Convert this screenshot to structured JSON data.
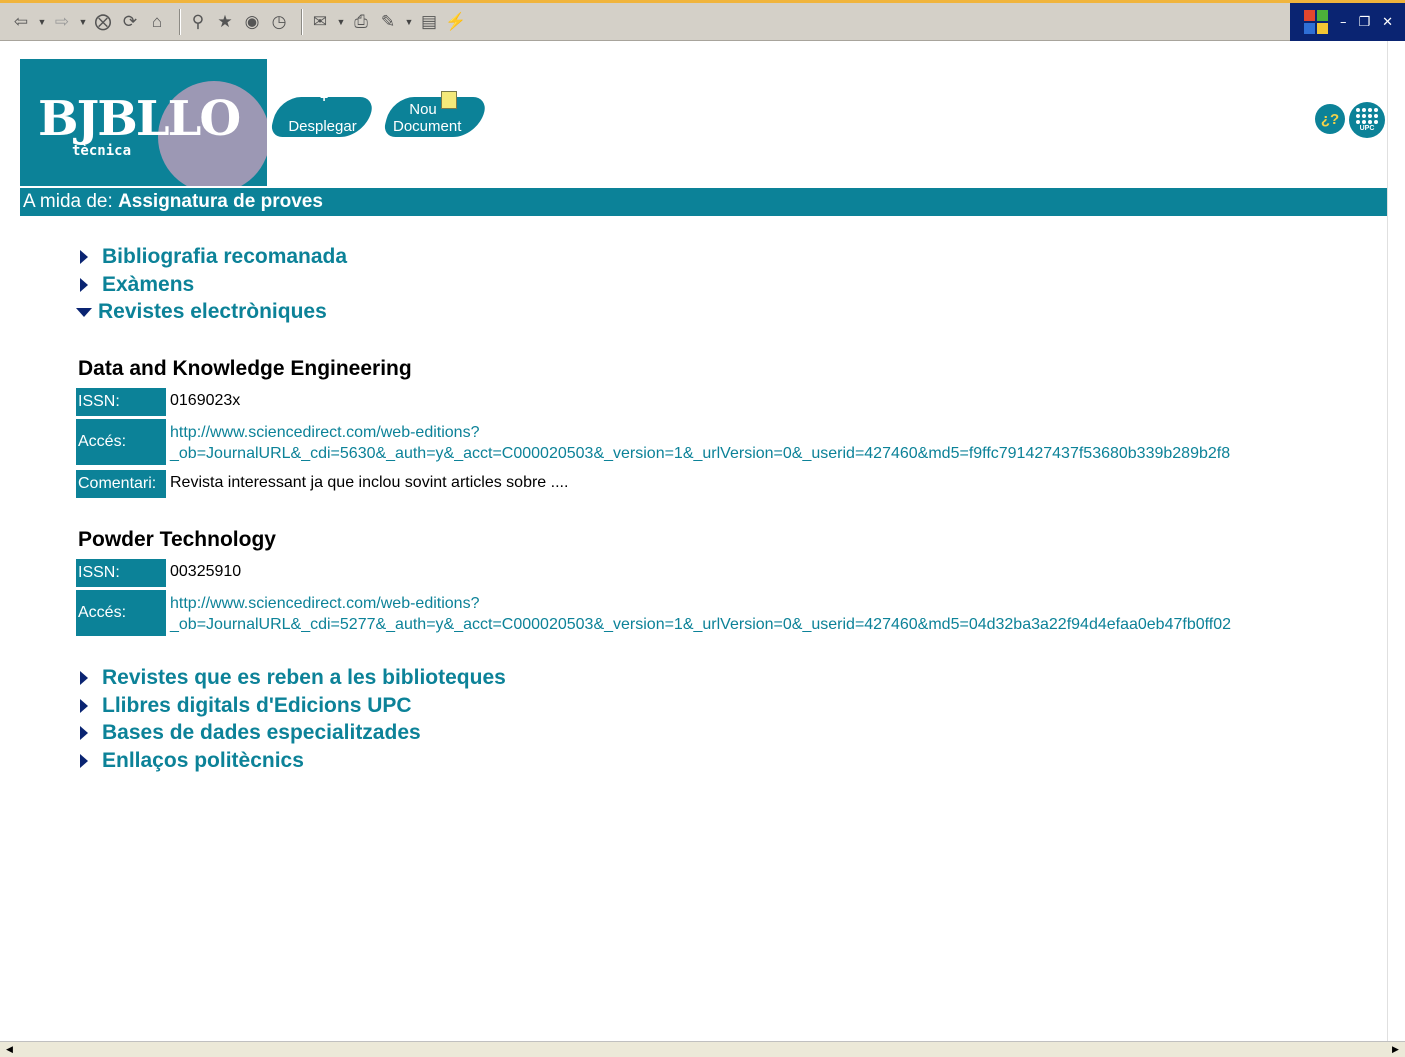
{
  "brand": {
    "logo_word": "BJBLLO",
    "logo_sub": "tècnica",
    "desplegar_label": "Desplegar",
    "nou_document_label": "Nou Document",
    "upc_badge": "UPC"
  },
  "header": {
    "prefix": "A mida de:",
    "title": "Assignatura de proves"
  },
  "sections_top": [
    {
      "label": "Bibliografia recomanada",
      "expanded": false
    },
    {
      "label": "Exàmens",
      "expanded": false
    },
    {
      "label": "Revistes electròniques",
      "expanded": true
    }
  ],
  "journals": [
    {
      "title": "Data and Knowledge Engineering",
      "issn_label": "ISSN:",
      "issn": "0169023x",
      "acces_label": "Accés:",
      "url_line1": "http://www.sciencedirect.com/web-editions?",
      "url_line2": "_ob=JournalURL&_cdi=5630&_auth=y&_acct=C000020503&_version=1&_urlVersion=0&_userid=427460&md5=f9ffc791427437f53680b339b289b2f8",
      "comentari_label": "Comentari:",
      "comentari": "Revista interessant ja que inclou sovint articles sobre ...."
    },
    {
      "title": "Powder Technology",
      "issn_label": "ISSN:",
      "issn": "00325910",
      "acces_label": "Accés:",
      "url_line1": "http://www.sciencedirect.com/web-editions?",
      "url_line2": "_ob=JournalURL&_cdi=5277&_auth=y&_acct=C000020503&_version=1&_urlVersion=0&_userid=427460&md5=04d32ba3a22f94d4efaa0eb47fb0ff02"
    }
  ],
  "sections_bottom": [
    {
      "label": "Revistes que es reben a les biblioteques"
    },
    {
      "label": "Llibres digitals d'Edicions UPC"
    },
    {
      "label": "Bases de dades especialitzades"
    },
    {
      "label": "Enllaços politècnics"
    }
  ],
  "toolbar_icons": [
    "back-arrow-icon",
    "forward-arrow-icon",
    "stop-icon",
    "refresh-icon",
    "home-icon",
    "search-icon",
    "favorites-icon",
    "media-icon",
    "history-icon",
    "mail-icon",
    "print-icon",
    "edit-icon",
    "discuss-icon",
    "flash-icon"
  ],
  "colors": {
    "accent": "#0c8298",
    "header_bar": "#0c8298",
    "arrow": "#0a2472",
    "link": "#0c8298"
  }
}
